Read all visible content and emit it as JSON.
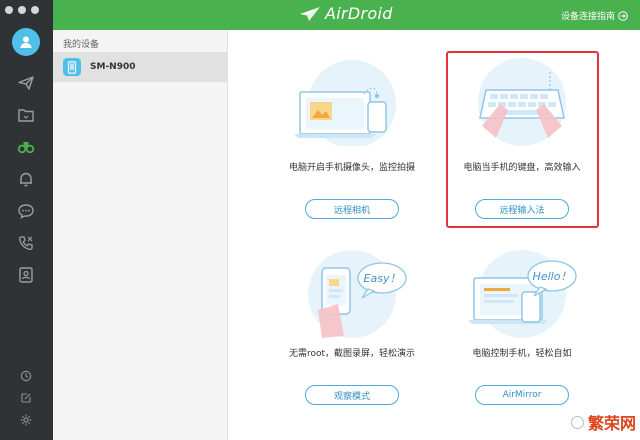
{
  "header": {
    "logo_text": "AirDroid",
    "guide_label": "设备连接指南"
  },
  "sidebar": {
    "icons": [
      "send-icon",
      "folder-icon",
      "binoculars-icon",
      "bell-icon",
      "chat-icon",
      "call-icon",
      "contacts-icon"
    ],
    "bottom_icons": [
      "clock-icon",
      "edit-icon",
      "settings-icon"
    ],
    "active": "binoculars-icon"
  },
  "devices": {
    "title": "我的设备",
    "items": [
      {
        "name": "SM-N900"
      }
    ]
  },
  "features": [
    {
      "desc": "电脑开启手机摄像头，监控拍摄",
      "button": "远程相机",
      "icon": "remote-camera-illustration"
    },
    {
      "desc": "电脑当手机的键盘，高效输入",
      "button": "远程输入法",
      "icon": "remote-keyboard-illustration",
      "highlighted": true
    },
    {
      "desc": "无需root，截图录屏，轻松演示",
      "button": "观察模式",
      "icon": "observe-mode-illustration",
      "bubble": "Easy！"
    },
    {
      "desc": "电脑控制手机，轻松自如",
      "button": "AirMirror",
      "icon": "airmirror-illustration",
      "bubble": "Hello！"
    }
  ],
  "watermark": "繁荣网",
  "colors": {
    "brand_green": "#49b14e",
    "rail_dark": "#2f3335",
    "accent_blue": "#4fc1e9",
    "button_border": "#4fa9d9",
    "highlight_red": "#e3343a"
  }
}
